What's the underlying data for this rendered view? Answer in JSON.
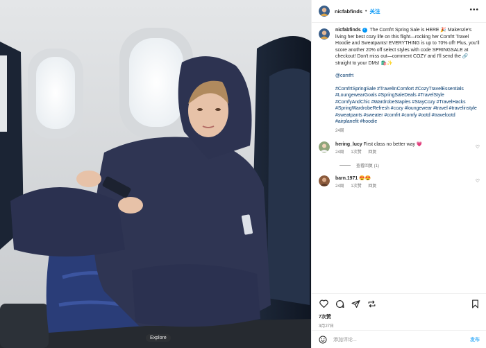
{
  "post": {
    "username": "nicfabfinds",
    "follow_label": "关注",
    "more_label": "•••",
    "explore_label": "Explore"
  },
  "caption": {
    "username": "nicfabfinds",
    "verified_mark": "✓",
    "text": "The Comfrt Spring Sale is HERE 🎉 Makenzie's living her best cozy life on this flight—rocking her Comfrt Travel Hoodie and Sweatpants! EVERYTHING is up to 70% off! Plus, you'll score another 20% off select styles with code SPRINGSALE at checkout! Don't miss out—comment COZY and I'll send the 🔗 straight to your DMs! 🛍️✨",
    "mention": "@comfrt",
    "hashtags": "#ComfrtSpringSale #TravelInComfort #CozyTravelEssentials #LoungewearGoals #SpringSaleDeals #TravelStyle #ComfyAndChic #WardrobeStaples #StayCozy #TravelHacks #SpringWardrobeRefresh #cozy #loungewear #travel #travelinstyle #sweatpants #sweater #comfrt #comfy #ootd #travelootd #airplanefit #hoodie",
    "age": "24周"
  },
  "comments": [
    {
      "username": "hering_lucy",
      "text": "First class no better way 💗",
      "age": "24周",
      "likes": "1次赞",
      "reply_label": "回复",
      "view_replies": "查看回复 (1)"
    },
    {
      "username": "barn.1971",
      "text": "😍😍",
      "age": "24周",
      "likes": "1次赞",
      "reply_label": "回复"
    }
  ],
  "engagement": {
    "likes": "7次赞",
    "date": "3月27日"
  },
  "composer": {
    "placeholder": "添加评论...",
    "post_label": "发布"
  }
}
